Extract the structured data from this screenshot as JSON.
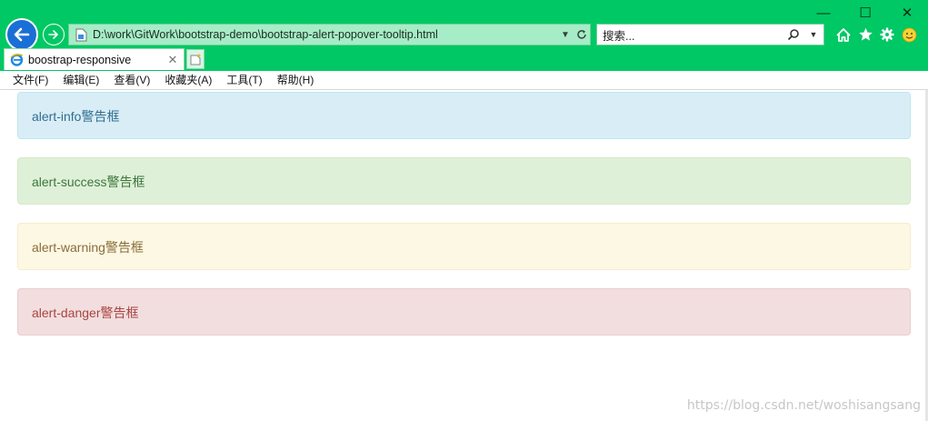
{
  "window": {
    "minimize_glyph": "—",
    "maximize_glyph": "☐",
    "close_glyph": "✕"
  },
  "address_bar": {
    "url": "D:\\work\\GitWork\\bootstrap-demo\\bootstrap-alert-popover-tooltip.html"
  },
  "search_box": {
    "placeholder": "搜索..."
  },
  "tab": {
    "label": "boostrap-responsive",
    "close_glyph": "✕"
  },
  "menu": {
    "items": [
      "文件(F)",
      "编辑(E)",
      "查看(V)",
      "收藏夹(A)",
      "工具(T)",
      "帮助(H)"
    ]
  },
  "alerts": {
    "info": "alert-info警告框",
    "success": "alert-success警告框",
    "warning": "alert-warning警告框",
    "danger": "alert-danger警告框"
  },
  "watermark": "https://blog.csdn.net/woshisangsang",
  "colors": {
    "chrome": "#00c864",
    "info_bg": "#d9edf7",
    "success_bg": "#dff0d8",
    "warning_bg": "#fcf8e3",
    "danger_bg": "#f2dede"
  },
  "icons": [
    "back-arrow-icon",
    "forward-arrow-icon",
    "page-icon",
    "dropdown-icon",
    "refresh-icon",
    "search-icon",
    "home-icon",
    "favorites-star-icon",
    "settings-gear-icon",
    "feedback-smiley-icon",
    "ie-logo-icon",
    "new-tab-icon"
  ]
}
